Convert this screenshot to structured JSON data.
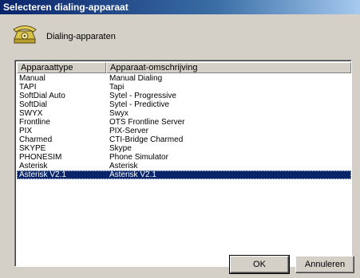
{
  "window": {
    "title": "Selecteren dialing-apparaat"
  },
  "header": {
    "icon": "telephone-icon",
    "label": "Dialing-apparaten"
  },
  "list": {
    "columns": [
      "Apparaattype",
      "Apparaat-omschrijving"
    ],
    "rows": [
      {
        "type": "Manual",
        "description": "Manual Dialing"
      },
      {
        "type": "TAPI",
        "description": "Tapi"
      },
      {
        "type": "SoftDial Auto",
        "description": "Sytel - Progressive"
      },
      {
        "type": "SoftDial",
        "description": "Sytel - Predictive"
      },
      {
        "type": "SWYX",
        "description": "Swyx"
      },
      {
        "type": "Frontline",
        "description": "OTS Frontline Server"
      },
      {
        "type": "PIX",
        "description": "PIX-Server"
      },
      {
        "type": "Charmed",
        "description": "CTI-Bridge Charmed"
      },
      {
        "type": "SKYPE",
        "description": "Skype"
      },
      {
        "type": "PHONESIM",
        "description": "Phone Simulator"
      },
      {
        "type": "Asterisk",
        "description": "Asterisk"
      },
      {
        "type": "Asterisk V2.1",
        "description": "Asterisk V2.1"
      }
    ],
    "selected_index": 11
  },
  "buttons": {
    "ok_label": "OK",
    "cancel_label": "Annuleren"
  },
  "colors": {
    "selection": "#0a246a",
    "face": "#d4d0c8",
    "titlebar": "#0a246a"
  }
}
